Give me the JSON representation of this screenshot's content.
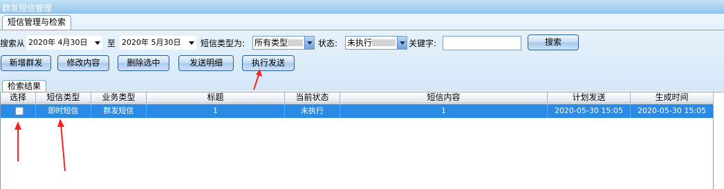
{
  "window": {
    "title": "群发短信管理"
  },
  "search_panel": {
    "legend": "短信管理与检索",
    "search_from_label": "搜索从",
    "date_from": "2020年  4月30日",
    "to_label": "至",
    "date_to": "2020年  5月30日",
    "sms_type_label": "短信类型为:",
    "sms_type_value": "所有类型",
    "status_label": "状态:",
    "status_value": "未执行",
    "keyword_label": "关键字:",
    "keyword_value": "",
    "search_button": "搜索"
  },
  "toolbar": {
    "add_button": "新增群发",
    "edit_button": "修改内容",
    "delete_button": "删除选中",
    "detail_button": "发送明细",
    "execute_button": "执行发送"
  },
  "results": {
    "tab_label": "检索结果",
    "columns": [
      "选择",
      "短信类型",
      "业务类型",
      "标题",
      "当前状态",
      "短信内容",
      "计划发送",
      "生成时间"
    ],
    "rows": [
      {
        "checked": false,
        "sms_type": "即时短信",
        "business_type": "群发短信",
        "title": "1",
        "status": "未执行",
        "content": "1",
        "planned_send": "2020-05-30 15:05",
        "created_time": "2020-05-30 15:05"
      }
    ]
  },
  "colors": {
    "title_bar": "#8ec3ea",
    "selected_row": "#2b8ae4",
    "annotation_arrow": "#ff2020"
  },
  "icons": [
    "dropdown-arrow-icon",
    "annotation-arrow-icon"
  ]
}
